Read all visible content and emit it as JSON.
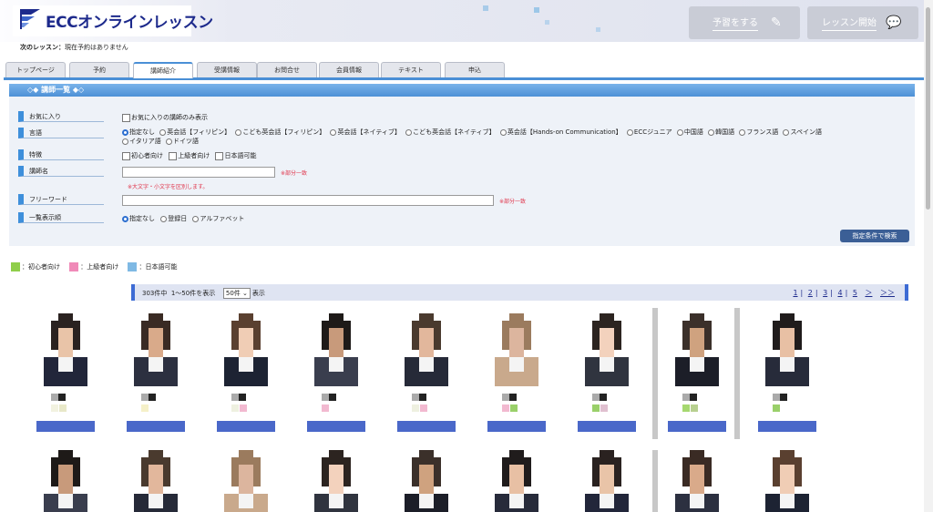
{
  "header": {
    "logo_text": "ECCオンラインレッスン",
    "reserve_button": "予習をする",
    "lesson_start_button": "レッスン開始"
  },
  "next_lesson": {
    "label": "次のレッスン：",
    "value": "現在予約はありません"
  },
  "tabs": [
    "トップページ",
    "予約",
    "講師紹介",
    "受講情報",
    "お問合せ",
    "会員情報",
    "テキスト",
    "申込"
  ],
  "active_tab": "講師紹介",
  "panel": {
    "title": "◇◆ 講師一覧 ◆◇",
    "favorites_label": "お気に入り",
    "favorites_option": "お気に入りの講師のみ表示",
    "language_label": "言語",
    "language_options_row1": [
      "指定なし",
      "英会話【フィリピン】",
      "こども英会話【フィリピン】",
      "英会話【ネイティブ】",
      "こども英会話【ネイティブ】",
      "英会話【Hands-on Communication】",
      "ECCジュニア",
      "中国語",
      "韓国語",
      "フランス語",
      "スペイン語"
    ],
    "language_options_row2": [
      "イタリア語",
      "ドイツ語"
    ],
    "feature_label": "特徴",
    "feature_options": [
      "初心者向け",
      "上級者向け",
      "日本語可能"
    ],
    "name_label": "講師名",
    "name_note": "※部分一致",
    "case_note": "※大文字・小文字を区別します。",
    "freeword_label": "フリーワード",
    "freeword_note": "※部分一致",
    "order_label": "一覧表示順",
    "order_options": [
      "指定なし",
      "登録日",
      "アルファベット"
    ],
    "search_button": "指定条件で検索"
  },
  "legend": {
    "beginner": "：初心者向け",
    "advanced": "：上級者向け",
    "japanese": "：日本語可能"
  },
  "results": {
    "count": "303件中",
    "range": "1〜50件を表示",
    "per_page": "50件",
    "per_page_suffix": "表示",
    "pages": [
      "1",
      "2",
      "3",
      "4",
      "5",
      "＞",
      "＞＞"
    ]
  },
  "colors": {
    "accent": "#4a8fd6",
    "brand": "#1d2a8c",
    "button": "#3b5f96",
    "note": "#e0344a"
  }
}
